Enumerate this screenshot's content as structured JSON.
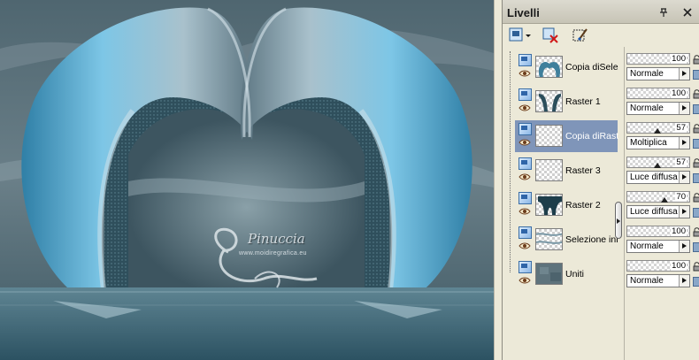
{
  "palette": {
    "title": "Livelli",
    "title_buttons": [
      "pin-icon",
      "close-icon"
    ],
    "toolbar": [
      "new-raster-layer-icon",
      "delete-layer-icon",
      "layer-properties-icon"
    ]
  },
  "watermark": {
    "name": "Pinuccia",
    "url": "www.moidiregrafica.eu"
  },
  "layers": [
    {
      "name": "Copia diSelez",
      "opacity": "100",
      "opacity_level": 1.0,
      "blend": "Normale",
      "selected": false,
      "thumb": "arch-icon"
    },
    {
      "name": "Raster 1",
      "opacity": "100",
      "opacity_level": 1.0,
      "blend": "Normale",
      "selected": false,
      "thumb": "curtain-icon"
    },
    {
      "name": "Copia diRaste",
      "opacity": "57",
      "opacity_level": 0.57,
      "blend": "Moltiplica",
      "selected": true,
      "thumb": "transparent-icon"
    },
    {
      "name": "Raster 3",
      "opacity": "57",
      "opacity_level": 0.57,
      "blend": "Luce diffusa",
      "selected": false,
      "thumb": "transparent-icon"
    },
    {
      "name": "Raster 2",
      "opacity": "70",
      "opacity_level": 0.7,
      "blend": "Luce diffusa",
      "selected": false,
      "thumb": "curtain-dark-icon"
    },
    {
      "name": "Selezione inn",
      "opacity": "100",
      "opacity_level": 1.0,
      "blend": "Normale",
      "selected": false,
      "thumb": "wave-icon"
    },
    {
      "name": "Uniti",
      "opacity": "100",
      "opacity_level": 1.0,
      "blend": "Normale",
      "selected": false,
      "thumb": "texture-icon"
    }
  ],
  "colors": {
    "selected_row": "#7f95b9",
    "canvas_teal": "#4a6470",
    "arch_blue": "#6fb6d8",
    "panel_bg": "#ece9d8"
  }
}
